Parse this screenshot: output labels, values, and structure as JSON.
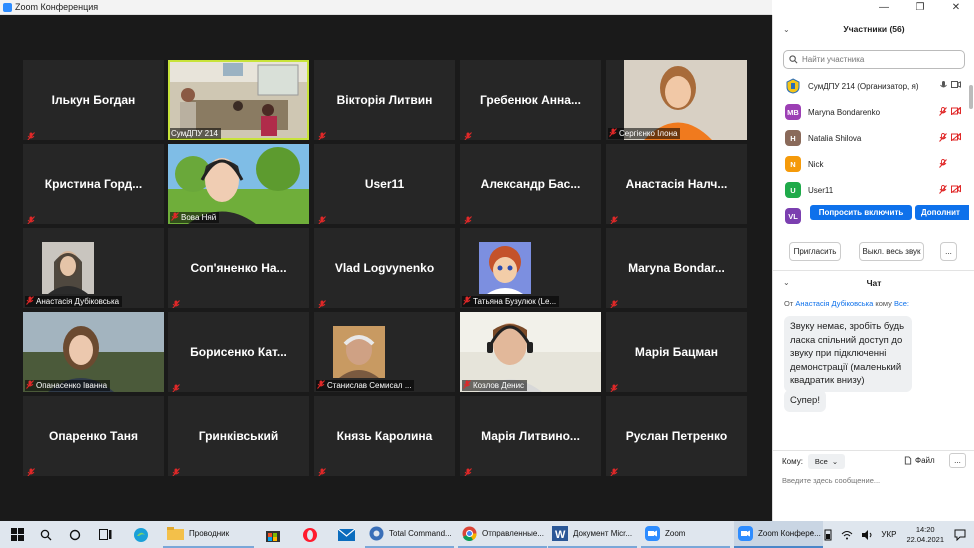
{
  "window": {
    "title": "Zoom Конференция"
  },
  "tiles": [
    {
      "name": "Ількун Богдан",
      "type": "name"
    },
    {
      "name": "",
      "label": "СумДПУ 214",
      "type": "video-classroom"
    },
    {
      "name": "Вікторія Литвин",
      "type": "name"
    },
    {
      "name": "Гребенюк Анна...",
      "type": "name"
    },
    {
      "name": "",
      "label": "Сергієнко Ілона",
      "type": "video-girl"
    },
    {
      "name": "Кристина Горд...",
      "type": "name"
    },
    {
      "name": "",
      "label": "Вова Няй",
      "type": "video-boy-landscape"
    },
    {
      "name": "User11",
      "type": "name"
    },
    {
      "name": "Александр Бас...",
      "type": "name"
    },
    {
      "name": "Анастасія Налч...",
      "type": "name"
    },
    {
      "name": "",
      "label": "Анастасія Дубіковська",
      "type": "photo-small"
    },
    {
      "name": "Соп'яненко На...",
      "type": "name"
    },
    {
      "name": "Vlad Logvynenko",
      "type": "name"
    },
    {
      "name": "",
      "label": "Татьяна Бузулюк (Le...",
      "type": "photo-cartoon"
    },
    {
      "name": "Maryna Bondar...",
      "type": "name"
    },
    {
      "name": "",
      "label": "Опанасенко Іванна",
      "type": "video-girl2"
    },
    {
      "name": "Борисенко Кат...",
      "type": "name"
    },
    {
      "name": "",
      "label": "Станислав Семисал ...",
      "type": "photo-old"
    },
    {
      "name": "",
      "label": "Козлов Денис",
      "type": "video-boy2"
    },
    {
      "name": "Марія Бацман",
      "type": "name"
    },
    {
      "name": "Опаренко Таня",
      "type": "name"
    },
    {
      "name": "Гринківський",
      "type": "name"
    },
    {
      "name": "Князь Каролина",
      "type": "name"
    },
    {
      "name": "Марія Литвино...",
      "type": "name"
    },
    {
      "name": "Руслан Петренко",
      "type": "name"
    }
  ],
  "participants": {
    "title": "Участники (56)",
    "search_placeholder": "Найти участника",
    "list": [
      {
        "initials": "",
        "name": "СумДПУ 214 (Организатор, я)",
        "color": "#f5c518",
        "mic": "on",
        "video": "on"
      },
      {
        "initials": "MB",
        "name": "Maryna Bondarenko",
        "color": "#9c3fb4",
        "mic": "muted",
        "video": "off"
      },
      {
        "initials": "H",
        "name": "Natalia Shilova",
        "color": "#8a6a5a",
        "mic": "muted",
        "video": "off"
      },
      {
        "initials": "N",
        "name": "Nick",
        "color": "#f59a0a",
        "mic": "muted",
        "video": "none"
      },
      {
        "initials": "U",
        "name": "User11",
        "color": "#1faa4a",
        "mic": "muted",
        "video": "off"
      },
      {
        "initials": "VL",
        "name": "",
        "color": "#7b3fb0",
        "mic": "",
        "video": ""
      }
    ],
    "ask_unmute": "Попросить включить",
    "more_label": "Дополнит",
    "invite": "Пригласить",
    "mute_all": "Выкл. весь звук",
    "more": "..."
  },
  "chat": {
    "title": "Чат",
    "from_prefix": "От",
    "from_name": "Анастасія Дубіковська",
    "to_word": "кому",
    "to_name": "Все:",
    "messages": [
      "Звуку немає, зробіть будь ласка спільний доступ до звуку при підключенні демонстрації (маленький квадратик внизу)",
      "Супер!"
    ],
    "to_label": "Кому:",
    "to_select": "Все",
    "file": "Файл",
    "more": "...",
    "input_placeholder": "Введите здесь сообщение..."
  },
  "taskbar": {
    "apps": [
      {
        "label": "Проводник"
      },
      {
        "label": "Total Command..."
      },
      {
        "label": "Отправленные..."
      },
      {
        "label": "Документ Micr..."
      },
      {
        "label": "Zoom"
      },
      {
        "label": "Zoom Конфере..."
      }
    ],
    "lang": "УКР",
    "time": "14:20",
    "date": "22.04.2021"
  }
}
